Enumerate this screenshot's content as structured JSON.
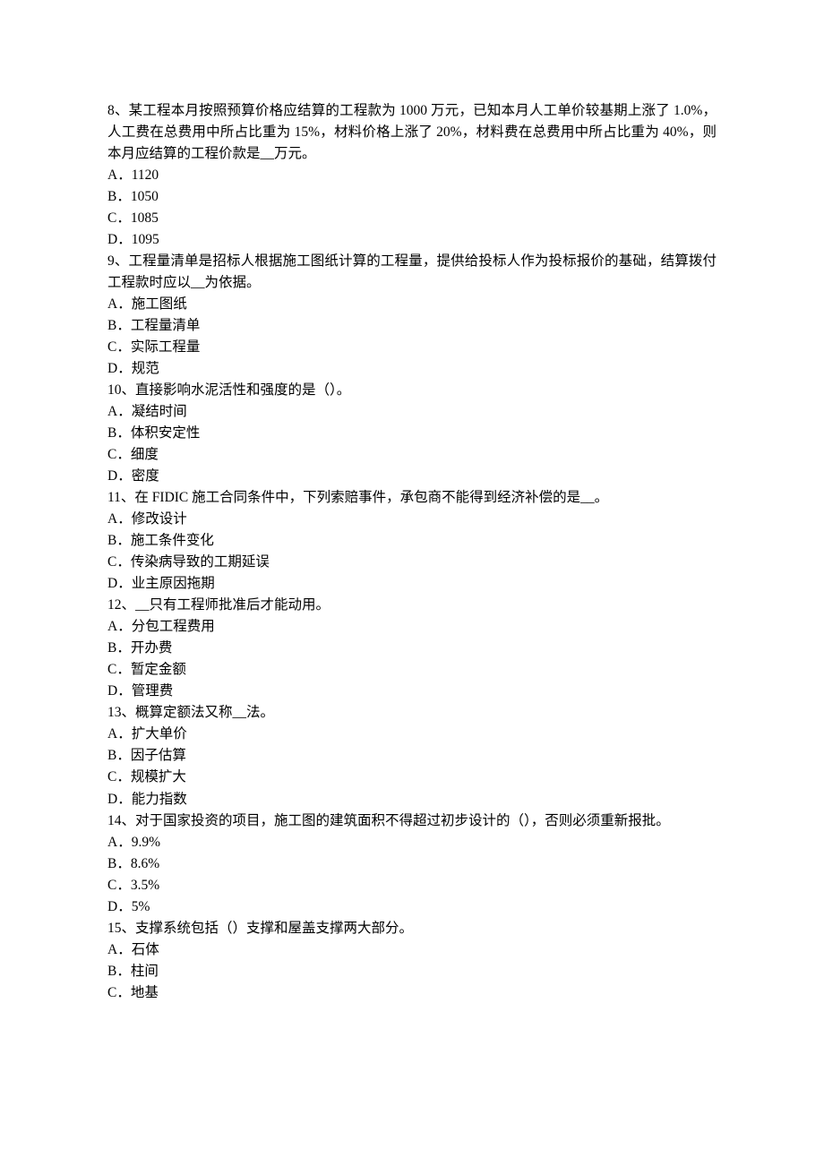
{
  "questions": [
    {
      "stem": "8、某工程本月按照预算价格应结算的工程款为 1000 万元，已知本月人工单价较基期上涨了 1.0%，人工费在总费用中所占比重为 15%，材料价格上涨了 20%，材料费在总费用中所占比重为 40%，则本月应结算的工程价款是__万元。",
      "options": [
        "A．1120",
        "B．1050",
        "C．1085",
        "D．1095"
      ]
    },
    {
      "stem": "9、工程量清单是招标人根据施工图纸计算的工程量，提供给投标人作为投标报价的基础，结算拨付工程款时应以__为依据。",
      "options": [
        "A．施工图纸",
        "B．工程量清单",
        "C．实际工程量",
        "D．规范"
      ]
    },
    {
      "stem": "10、直接影响水泥活性和强度的是（）。",
      "options": [
        "A．凝结时间",
        "B．体积安定性",
        "C．细度",
        "D．密度"
      ]
    },
    {
      "stem": "11、在 FIDIC 施工合同条件中，下列索赔事件，承包商不能得到经济补偿的是__。",
      "options": [
        "A．修改设计",
        "B．施工条件变化",
        "C．传染病导致的工期延误",
        "D．业主原因拖期"
      ]
    },
    {
      "stem": "12、__只有工程师批准后才能动用。",
      "options": [
        "A．分包工程费用",
        "B．开办费",
        "C．暂定金额",
        "D．管理费"
      ]
    },
    {
      "stem": "13、概算定额法又称__法。",
      "options": [
        "A．扩大单价",
        "B．因子估算",
        "C．规模扩大",
        "D．能力指数"
      ]
    },
    {
      "stem": "14、对于国家投资的项目，施工图的建筑面积不得超过初步设计的（），否则必须重新报批。",
      "options": [
        "A．9.9%",
        "B．8.6%",
        "C．3.5%",
        "D．5%"
      ]
    },
    {
      "stem": "15、支撑系统包括（）支撑和屋盖支撑两大部分。",
      "options": [
        "A．石体",
        "B．柱间",
        "C．地基"
      ]
    }
  ]
}
